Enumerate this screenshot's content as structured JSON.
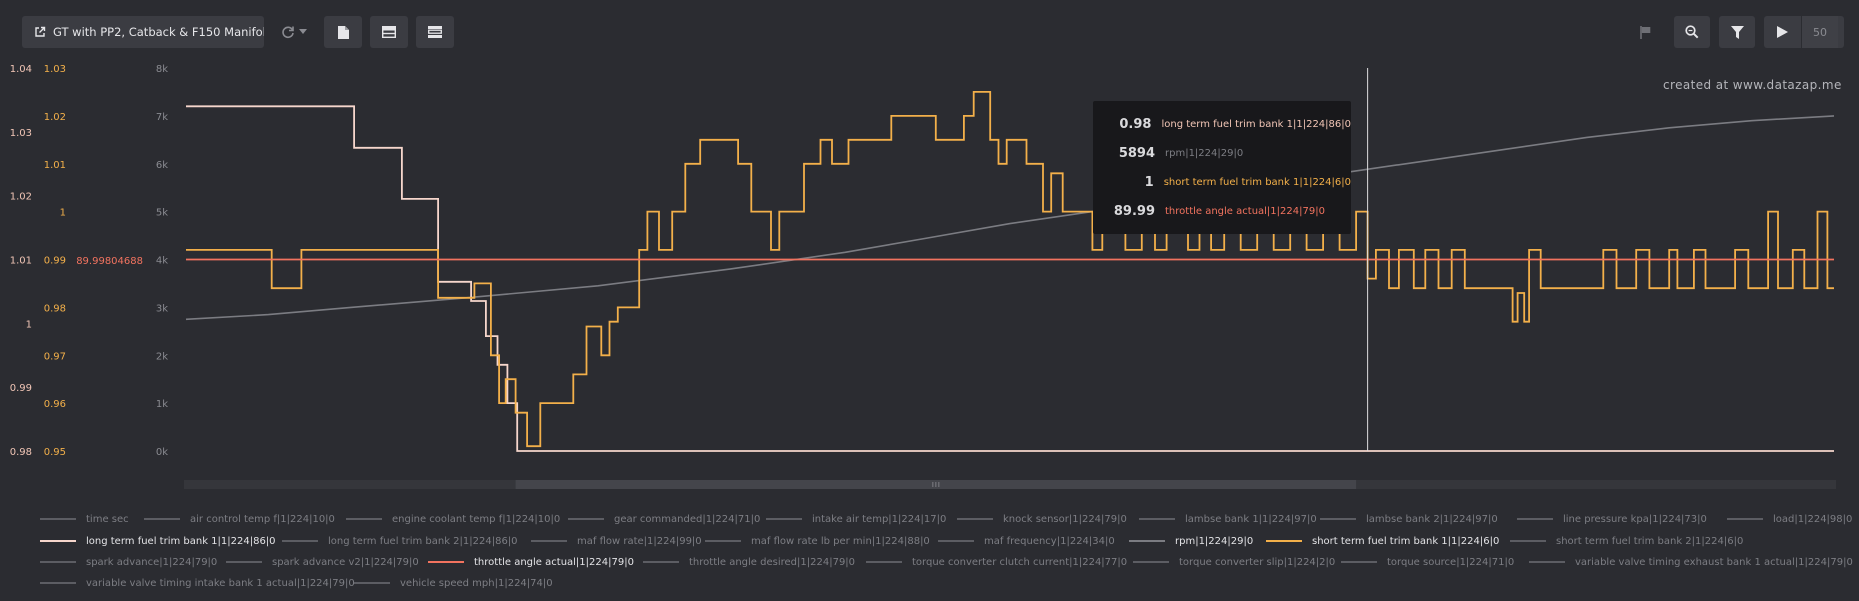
{
  "toolbar": {
    "title": "GT with PP2, Catback & F150 Manifol...",
    "playback_rate": "50",
    "icons": [
      "external-link-icon",
      "refresh-icon",
      "chevron-down-icon",
      "document-icon",
      "split-view-icon",
      "stacked-view-icon",
      "flag-icon",
      "zoom-icon",
      "filter-icon",
      "play-icon"
    ]
  },
  "watermark": "created at www.datazap.me",
  "axes": {
    "rpm_ticks": [
      "8k",
      "7k",
      "6k",
      "5k",
      "4k",
      "3k",
      "2k",
      "1k",
      "0k"
    ],
    "stft_ticks": [
      "1.03",
      "1.02",
      "1.01",
      "1",
      "0.99",
      "0.98",
      "0.97",
      "0.96",
      "0.95"
    ],
    "ltft_ticks": [
      "1.04",
      "1.03",
      "1.02",
      "1.01",
      "1",
      "0.99",
      "0.98"
    ],
    "throttle_tick": "89.99804688"
  },
  "tooltip": [
    {
      "value": "0.98",
      "label": "long term fuel trim bank 1|1|224|86|0",
      "color": "#f2c6b6"
    },
    {
      "value": "5894",
      "label": "rpm|1|224|29|0",
      "color": "#7d7e84"
    },
    {
      "value": "1",
      "label": "short term fuel trim bank 1|1|224|6|0",
      "color": "#f3b04a"
    },
    {
      "value": "89.99",
      "label": "throttle angle actual|1|224|79|0",
      "color": "#f2735f"
    }
  ],
  "colors": {
    "background": "#2b2c31",
    "ltft": "#f6d6cc",
    "stft": "#f3b04a",
    "throttle": "#f2735f",
    "rpm": "#7b7c82",
    "inactive": "#7d7e84"
  },
  "legend": [
    {
      "label": "time sec",
      "active": false
    },
    {
      "label": "air control temp f|1|224|10|0",
      "active": false
    },
    {
      "label": "engine coolant temp f|1|224|10|0",
      "active": false
    },
    {
      "label": "gear commanded|1|224|71|0",
      "active": false
    },
    {
      "label": "intake air temp|1|224|17|0",
      "active": false
    },
    {
      "label": "knock sensor|1|224|79|0",
      "active": false
    },
    {
      "label": "lambse bank 1|1|224|97|0",
      "active": false
    },
    {
      "label": "lambse bank 2|1|224|97|0",
      "active": false
    },
    {
      "label": "line pressure kpa|1|224|73|0",
      "active": false
    },
    {
      "label": "load|1|224|98|0",
      "active": false
    },
    {
      "label": "long term fuel trim bank 1|1|224|86|0",
      "active": true,
      "color": "#f6d6cc"
    },
    {
      "label": "long term fuel trim bank 2|1|224|86|0",
      "active": false
    },
    {
      "label": "maf flow rate|1|224|99|0",
      "active": false
    },
    {
      "label": "maf flow rate lb per min|1|224|88|0",
      "active": false
    },
    {
      "label": "maf frequency|1|224|34|0",
      "active": false
    },
    {
      "label": "rpm|1|224|29|0",
      "active": true,
      "color": "#7b7c82"
    },
    {
      "label": "short term fuel trim bank 1|1|224|6|0",
      "active": true,
      "color": "#f3b04a"
    },
    {
      "label": "short term fuel trim bank 2|1|224|6|0",
      "active": false
    },
    {
      "label": "spark advance|1|224|79|0",
      "active": false
    },
    {
      "label": "spark advance v2|1|224|79|0",
      "active": false
    },
    {
      "label": "throttle angle actual|1|224|79|0",
      "active": true,
      "color": "#f2735f"
    },
    {
      "label": "throttle angle desired|1|224|79|0",
      "active": false
    },
    {
      "label": "torque converter clutch current|1|224|77|0",
      "active": false
    },
    {
      "label": "torque converter slip|1|224|2|0",
      "active": false
    },
    {
      "label": "torque source|1|224|71|0",
      "active": false
    },
    {
      "label": "variable valve timing exhaust bank 1 actual|1|224|79|0",
      "active": false
    },
    {
      "label": "variable valve timing intake bank 1 actual|1|224|79|0",
      "active": false
    },
    {
      "label": "vehicle speed mph|1|224|74|0",
      "active": false
    }
  ],
  "chart_data": {
    "type": "line",
    "x_range": [
      0,
      1000
    ],
    "cursor_x": 717,
    "view_window": [
      0.2,
      0.71
    ],
    "series": [
      {
        "name": "rpm|1|224|29|0",
        "axis": "rpm",
        "range": [
          0,
          8000
        ],
        "points": [
          [
            0,
            2750
          ],
          [
            50,
            2850
          ],
          [
            100,
            3000
          ],
          [
            170,
            3200
          ],
          [
            250,
            3450
          ],
          [
            330,
            3800
          ],
          [
            400,
            4150
          ],
          [
            450,
            4450
          ],
          [
            500,
            4750
          ],
          [
            550,
            5000
          ],
          [
            600,
            5250
          ],
          [
            650,
            5500
          ],
          [
            700,
            5800
          ],
          [
            750,
            6050
          ],
          [
            800,
            6300
          ],
          [
            850,
            6550
          ],
          [
            900,
            6750
          ],
          [
            950,
            6900
          ],
          [
            1000,
            7000
          ]
        ]
      },
      {
        "name": "long term fuel trim bank 1|1|224|86|0",
        "axis": "ltft",
        "range": [
          0.98,
          1.04
        ],
        "points": [
          [
            0,
            1.034
          ],
          [
            102,
            1.034
          ],
          [
            102,
            1.0275
          ],
          [
            131,
            1.0275
          ],
          [
            131,
            1.0195
          ],
          [
            153,
            1.0195
          ],
          [
            153,
            1.0065
          ],
          [
            173,
            1.0065
          ],
          [
            173,
            1.0035
          ],
          [
            182,
            1.0035
          ],
          [
            182,
            0.998
          ],
          [
            189,
            0.998
          ],
          [
            189,
            0.9935
          ],
          [
            195,
            0.9935
          ],
          [
            195,
            0.9875
          ],
          [
            201,
            0.9875
          ],
          [
            201,
            0.98
          ],
          [
            207,
            0.98
          ],
          [
            207,
            0.98
          ],
          [
            1000,
            0.98
          ]
        ]
      },
      {
        "name": "short term fuel trim bank 1|1|224|6|0",
        "axis": "stft",
        "range": [
          0.95,
          1.03
        ],
        "points": [
          [
            0,
            0.992
          ],
          [
            52,
            0.992
          ],
          [
            52,
            0.984
          ],
          [
            70,
            0.984
          ],
          [
            70,
            0.992
          ],
          [
            153,
            0.992
          ],
          [
            153,
            0.982
          ],
          [
            175,
            0.982
          ],
          [
            175,
            0.985
          ],
          [
            185,
            0.985
          ],
          [
            185,
            0.97
          ],
          [
            190,
            0.97
          ],
          [
            190,
            0.96
          ],
          [
            194,
            0.96
          ],
          [
            194,
            0.965
          ],
          [
            200,
            0.965
          ],
          [
            200,
            0.958
          ],
          [
            207,
            0.958
          ],
          [
            207,
            0.951
          ],
          [
            215,
            0.951
          ],
          [
            215,
            0.96
          ],
          [
            235,
            0.96
          ],
          [
            235,
            0.966
          ],
          [
            243,
            0.966
          ],
          [
            243,
            0.976
          ],
          [
            252,
            0.976
          ],
          [
            252,
            0.97
          ],
          [
            257,
            0.97
          ],
          [
            257,
            0.977
          ],
          [
            262,
            0.977
          ],
          [
            262,
            0.98
          ],
          [
            275,
            0.98
          ],
          [
            275,
            0.992
          ],
          [
            280,
            0.992
          ],
          [
            280,
            1
          ],
          [
            287,
            1
          ],
          [
            287,
            0.992
          ],
          [
            295,
            0.992
          ],
          [
            295,
            1
          ],
          [
            303,
            1
          ],
          [
            303,
            1.01
          ],
          [
            312,
            1.01
          ],
          [
            312,
            1.015
          ],
          [
            335,
            1.015
          ],
          [
            335,
            1.01
          ],
          [
            343,
            1.01
          ],
          [
            343,
            1
          ],
          [
            355,
            1
          ],
          [
            355,
            0.992
          ],
          [
            360,
            0.992
          ],
          [
            360,
            1
          ],
          [
            375,
            1
          ],
          [
            375,
            1.01
          ],
          [
            385,
            1.01
          ],
          [
            385,
            1.015
          ],
          [
            392,
            1.015
          ],
          [
            392,
            1.01
          ],
          [
            402,
            1.01
          ],
          [
            402,
            1.015
          ],
          [
            428,
            1.015
          ],
          [
            428,
            1.02
          ],
          [
            455,
            1.02
          ],
          [
            455,
            1.015
          ],
          [
            472,
            1.015
          ],
          [
            472,
            1.02
          ],
          [
            478,
            1.02
          ],
          [
            478,
            1.025
          ],
          [
            488,
            1.025
          ],
          [
            488,
            1.015
          ],
          [
            493,
            1.015
          ],
          [
            493,
            1.01
          ],
          [
            498,
            1.01
          ],
          [
            498,
            1.015
          ],
          [
            510,
            1.015
          ],
          [
            510,
            1.01
          ],
          [
            520,
            1.01
          ],
          [
            520,
            1.0
          ],
          [
            525,
            1.0
          ],
          [
            525,
            1.008
          ],
          [
            532,
            1.008
          ],
          [
            532,
            1.0
          ],
          [
            550,
            1.0
          ],
          [
            550,
            0.992
          ],
          [
            556,
            0.992
          ],
          [
            556,
            1.0
          ],
          [
            570,
            1.0
          ],
          [
            570,
            0.992
          ],
          [
            580,
            0.992
          ],
          [
            580,
            1.0
          ],
          [
            588,
            1.0
          ],
          [
            588,
            0.992
          ],
          [
            595,
            0.992
          ],
          [
            595,
            1.0
          ],
          [
            608,
            1.0
          ],
          [
            608,
            0.992
          ],
          [
            615,
            0.992
          ],
          [
            615,
            1.0
          ],
          [
            622,
            1.0
          ],
          [
            622,
            0.992
          ],
          [
            630,
            0.992
          ],
          [
            630,
            1.0
          ],
          [
            640,
            1.0
          ],
          [
            640,
            0.992
          ],
          [
            650,
            0.992
          ],
          [
            650,
            1.0
          ],
          [
            660,
            1.0
          ],
          [
            660,
            0.992
          ],
          [
            670,
            0.992
          ],
          [
            670,
            1.0
          ],
          [
            680,
            1.0
          ],
          [
            680,
            0.992
          ],
          [
            690,
            0.992
          ],
          [
            690,
            1.0
          ],
          [
            700,
            1.0
          ],
          [
            700,
            0.992
          ],
          [
            710,
            0.992
          ],
          [
            710,
            1.0
          ],
          [
            717,
            1.0
          ],
          [
            717,
            0.986
          ],
          [
            722,
            0.986
          ],
          [
            722,
            0.992
          ],
          [
            730,
            0.992
          ],
          [
            730,
            0.984
          ],
          [
            736,
            0.984
          ],
          [
            736,
            0.992
          ],
          [
            745,
            0.992
          ],
          [
            745,
            0.984
          ],
          [
            752,
            0.984
          ],
          [
            752,
            0.992
          ],
          [
            760,
            0.992
          ],
          [
            760,
            0.984
          ],
          [
            768,
            0.984
          ],
          [
            768,
            0.992
          ],
          [
            776,
            0.992
          ],
          [
            776,
            0.984
          ],
          [
            805,
            0.984
          ],
          [
            805,
            0.977
          ],
          [
            808,
            0.977
          ],
          [
            808,
            0.983
          ],
          [
            812,
            0.983
          ],
          [
            812,
            0.977
          ],
          [
            815,
            0.977
          ],
          [
            815,
            0.992
          ],
          [
            822,
            0.992
          ],
          [
            822,
            0.984
          ],
          [
            860,
            0.984
          ],
          [
            860,
            0.992
          ],
          [
            868,
            0.992
          ],
          [
            868,
            0.984
          ],
          [
            880,
            0.984
          ],
          [
            880,
            0.992
          ],
          [
            888,
            0.992
          ],
          [
            888,
            0.984
          ],
          [
            900,
            0.984
          ],
          [
            900,
            0.992
          ],
          [
            905,
            0.992
          ],
          [
            905,
            0.984
          ],
          [
            915,
            0.984
          ],
          [
            915,
            0.992
          ],
          [
            922,
            0.992
          ],
          [
            922,
            0.984
          ],
          [
            940,
            0.984
          ],
          [
            940,
            0.992
          ],
          [
            948,
            0.992
          ],
          [
            948,
            0.984
          ],
          [
            960,
            0.984
          ],
          [
            960,
            1.0
          ],
          [
            966,
            1.0
          ],
          [
            966,
            0.984
          ],
          [
            975,
            0.984
          ],
          [
            975,
            0.992
          ],
          [
            982,
            0.992
          ],
          [
            982,
            0.984
          ],
          [
            990,
            0.984
          ],
          [
            990,
            1.0
          ],
          [
            996,
            1.0
          ],
          [
            996,
            0.984
          ],
          [
            1000,
            0.984
          ]
        ]
      },
      {
        "name": "throttle angle actual|1|224|79|0",
        "axis": "throttle",
        "value": 89.99804688
      }
    ]
  }
}
